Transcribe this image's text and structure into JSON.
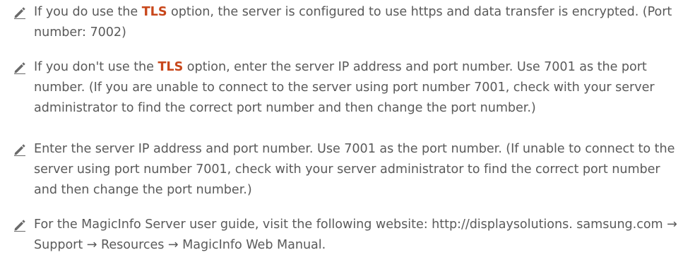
{
  "notes": [
    {
      "segments": [
        {
          "text": "If you do use the ",
          "emphasis": false
        },
        {
          "text": "TLS",
          "emphasis": true
        },
        {
          "text": " option, the server is configured to use https and data transfer is encrypted. (Port number: 7002)",
          "emphasis": false
        }
      ]
    },
    {
      "segments": [
        {
          "text": "If you don't use the ",
          "emphasis": false
        },
        {
          "text": "TLS",
          "emphasis": true
        },
        {
          "text": " option, enter the server IP address and port number. Use 7001 as the port number. (If you are unable to connect to the server using port number 7001, check with your server administrator to find the correct port number and then change the port number.)",
          "emphasis": false
        }
      ]
    },
    {
      "segments": [
        {
          "text": "Enter the server IP address and port number. Use 7001 as the port number. (If unable to connect to the server using port number 7001, check with your server administrator to find the correct port number and then change the port number.)",
          "emphasis": false
        }
      ]
    },
    {
      "segments": [
        {
          "text": "For the MagicInfo Server user guide, visit the following website: http://displaysolutions. samsung.com → Support → Resources → MagicInfo Web Manual.",
          "emphasis": false
        }
      ]
    }
  ],
  "note_icon": "pencil-icon",
  "colors": {
    "body_text": "#5a5a5a",
    "highlight": "#c8471b",
    "icon": "#6a6a6a"
  }
}
